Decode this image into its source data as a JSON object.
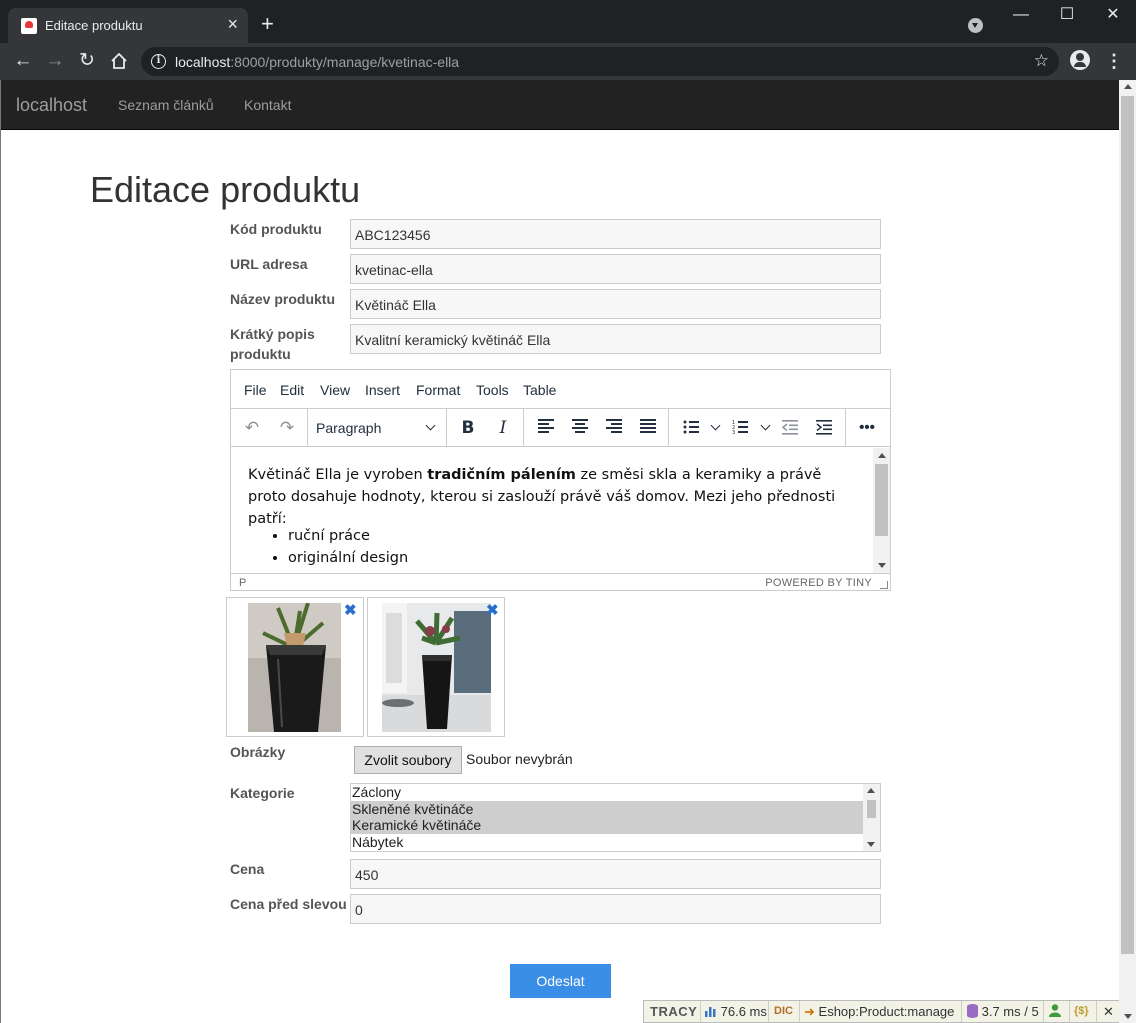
{
  "browser": {
    "tab_title": "Editace produktu",
    "tab_close": "×",
    "new_tab": "+",
    "url_host": "localhost",
    "url_rest": ":8000/produkty/manage/kvetinac-ella",
    "window_controls": [
      "—",
      "☐",
      "✕"
    ]
  },
  "navbar": {
    "brand": "localhost",
    "links": [
      "Seznam článků",
      "Kontakt"
    ]
  },
  "page": {
    "title": "Editace produktu"
  },
  "form": {
    "code": {
      "label": "Kód produktu",
      "value": "ABC123456"
    },
    "url": {
      "label": "URL adresa",
      "value": "kvetinac-ella"
    },
    "name": {
      "label": "Název produktu",
      "value": "Květináč Ella"
    },
    "short_desc": {
      "label_line1": "Krátký popis",
      "label_line2": "produktu",
      "value": "Kvalitní keramický květináč Ella"
    },
    "images_label": "Obrázky",
    "file_button": "Zvolit soubory",
    "file_status": "Soubor nevybrán",
    "category_label": "Kategorie",
    "categories": [
      {
        "name": "Záclony",
        "selected": false
      },
      {
        "name": "Skleněné květináče",
        "selected": true
      },
      {
        "name": "Keramické květináče",
        "selected": true
      },
      {
        "name": "Nábytek",
        "selected": false
      }
    ],
    "price": {
      "label": "Cena",
      "value": "450"
    },
    "old_price": {
      "label": "Cena před slevou",
      "value": "0"
    },
    "submit": "Odeslat"
  },
  "editor": {
    "menu": [
      "File",
      "Edit",
      "View",
      "Insert",
      "Format",
      "Tools",
      "Table"
    ],
    "block_format": "Paragraph",
    "content": {
      "text_before": "Květináč Ella je vyroben ",
      "text_bold": "tradičním pálením",
      "text_after": " ze směsi skla a keramiky a právě proto dosahuje hodnoty, kterou si zaslouží právě váš domov. Mezi jeho přednosti patří:",
      "list": [
        "ruční práce",
        "originální design"
      ]
    },
    "status_path": "P",
    "status_brand": "POWERED BY TINY"
  },
  "product_images": [
    {
      "delete": "✖"
    },
    {
      "delete": "✖"
    }
  ],
  "tracy": {
    "logo": "TRACY",
    "time": "76.6 ms",
    "dic": "DIC",
    "presenter": "Eshop:Product:manage",
    "db": "3.7 ms / 5",
    "close": "✕"
  },
  "colors": {
    "navbar_bg": "#222222",
    "submit_bg": "#3a8ee6",
    "delete_icon": "#2a6fc9",
    "selected_option": "#cecece",
    "tracy_bg": "#f2f2e6"
  }
}
